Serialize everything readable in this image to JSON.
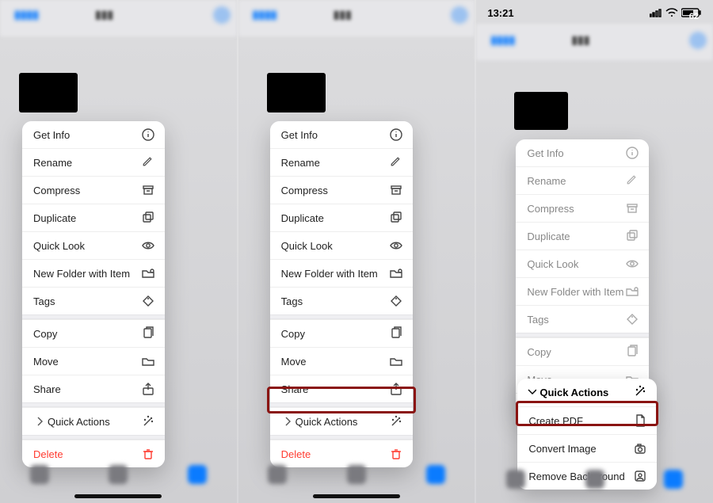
{
  "status": {
    "time": "13:21",
    "battery": "62"
  },
  "menu": {
    "items": [
      {
        "label": "Get Info",
        "icon": "info-icon"
      },
      {
        "label": "Rename",
        "icon": "pencil-icon"
      },
      {
        "label": "Compress",
        "icon": "archive-icon"
      },
      {
        "label": "Duplicate",
        "icon": "duplicate-icon"
      },
      {
        "label": "Quick Look",
        "icon": "eye-icon"
      },
      {
        "label": "New Folder with Item",
        "icon": "folder-badge-icon"
      },
      {
        "label": "Tags",
        "icon": "tag-icon"
      }
    ],
    "group2": [
      {
        "label": "Copy",
        "icon": "copy-icon"
      },
      {
        "label": "Move",
        "icon": "folder-icon"
      },
      {
        "label": "Share",
        "icon": "share-icon"
      }
    ],
    "quick_actions_label": "Quick Actions",
    "quick_actions_icon": "wand-icon",
    "delete_label": "Delete",
    "delete_icon": "trash-icon"
  },
  "quick_actions_submenu": {
    "header": "Quick Actions",
    "items": [
      {
        "label": "Create PDF",
        "icon": "doc-icon"
      },
      {
        "label": "Convert Image",
        "icon": "camera-icon"
      },
      {
        "label": "Remove Background",
        "icon": "person-crop-icon"
      }
    ]
  }
}
